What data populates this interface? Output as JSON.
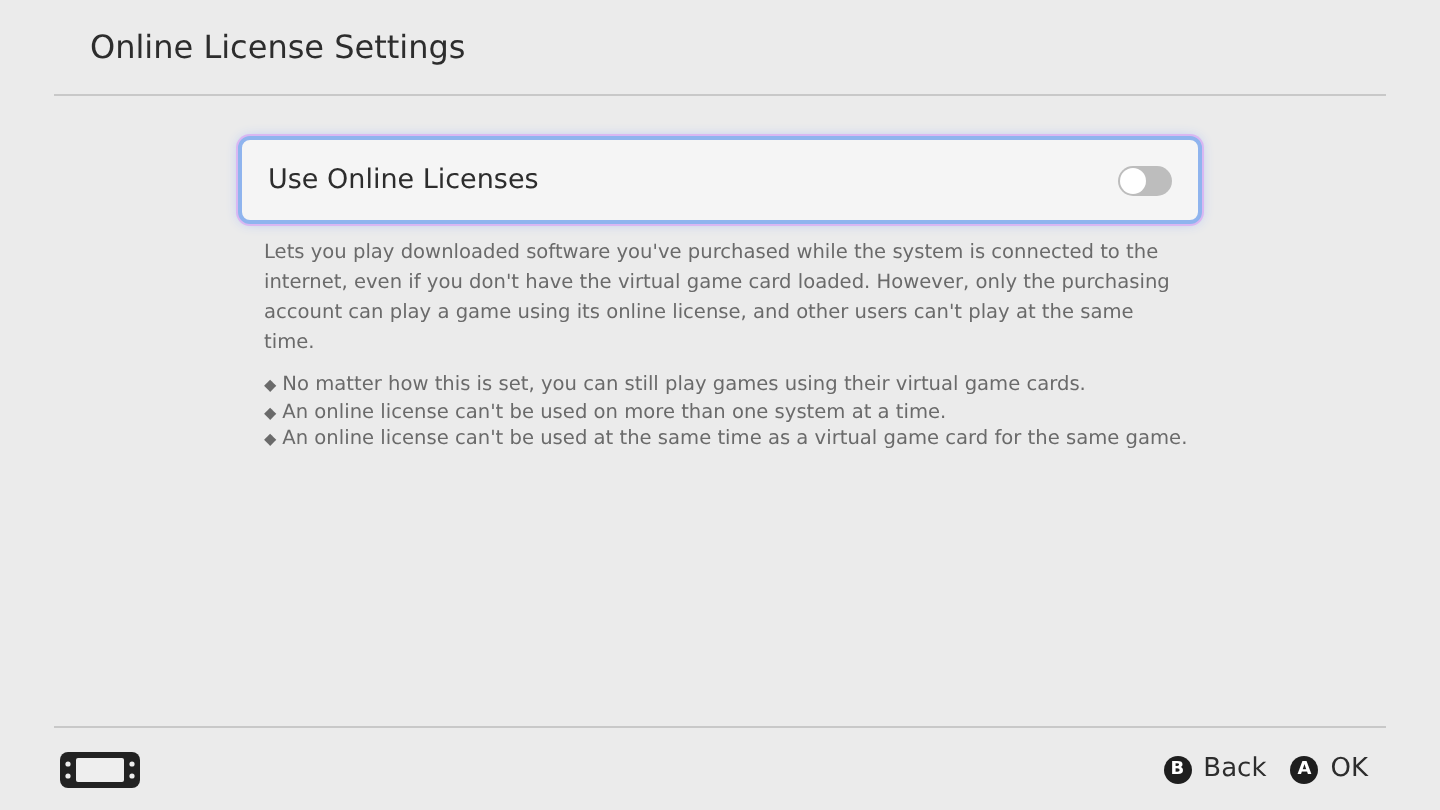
{
  "header": {
    "title": "Online License Settings"
  },
  "setting": {
    "label": "Use Online Licenses",
    "on": false,
    "selected": true
  },
  "description": "Lets you play downloaded software you've purchased while the system is connected to the internet, even if you don't have the virtual game card loaded. However, only the purchasing account can play a game using its online license, and other users can't play at the same time.",
  "notes": [
    {
      "mark": "◆",
      "text": "No matter how this is set, you can still play games using their virtual game cards."
    },
    {
      "mark": "◆",
      "text": "An online license can't be used on more than one system at a time."
    },
    {
      "mark": "◆",
      "text": "An online license can't be used at the same time as a virtual game card for the same game."
    }
  ],
  "footer": {
    "buttons": [
      {
        "key": "B",
        "label": "Back"
      },
      {
        "key": "A",
        "label": "OK"
      }
    ]
  }
}
